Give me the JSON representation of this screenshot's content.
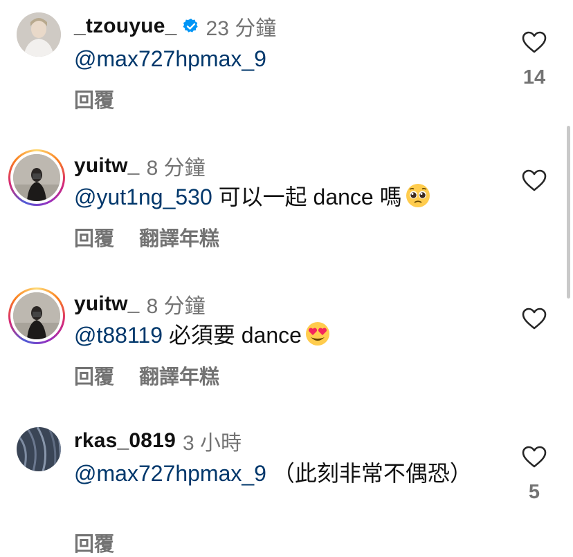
{
  "comments": [
    {
      "username": "_tzouyue_",
      "verified": true,
      "time": "23 分鐘",
      "mention": "@max727hpmax_9",
      "text": "",
      "actions": [
        "回覆"
      ],
      "likes": "14",
      "story_ring": false
    },
    {
      "username": "yuitw_",
      "verified": false,
      "time": "8 分鐘",
      "mention": "@yut1ng_530",
      "text": " 可以一起 dance 嗎",
      "emoji": "pleading-face",
      "actions": [
        "回覆",
        "翻譯年糕"
      ],
      "likes": "",
      "story_ring": true
    },
    {
      "username": "yuitw_",
      "verified": false,
      "time": "8 分鐘",
      "mention": "@t88119",
      "text": " 必須要 dance",
      "emoji": "heart-eyes-face",
      "actions": [
        "回覆",
        "翻譯年糕"
      ],
      "likes": "",
      "story_ring": true
    },
    {
      "username": "rkas_0819",
      "verified": false,
      "time": "3 小時",
      "mention": "@max727hpmax_9",
      "text": " （此刻非常不偶恐）",
      "actions": [
        "回覆"
      ],
      "likes": "5",
      "story_ring": false
    }
  ],
  "colors": {
    "mention": "#00376b",
    "secondary_text": "#737373",
    "verified_badge": "#0095f6"
  },
  "icons": {
    "like": "heart-outline-icon",
    "verified": "verified-badge-icon"
  }
}
